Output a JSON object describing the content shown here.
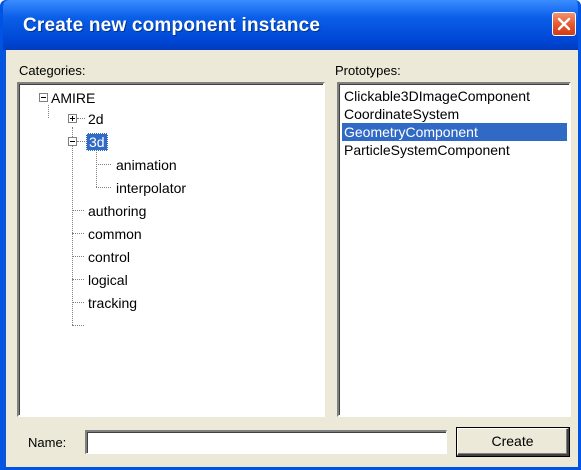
{
  "window": {
    "title": "Create new component instance"
  },
  "categories": {
    "label": "Categories:",
    "tree": {
      "root": "AMIRE",
      "node_2d": "2d",
      "node_3d": "3d",
      "child_animation": "animation",
      "child_interpolator": "interpolator",
      "authoring": "authoring",
      "common": "common",
      "control": "control",
      "logical": "logical",
      "tracking": "tracking"
    }
  },
  "prototypes": {
    "label": "Prototypes:",
    "items": [
      "Clickable3DImageComponent",
      "CoordinateSystem",
      "GeometryComponent",
      "ParticleSystemComponent"
    ],
    "selected_index": 2
  },
  "name_field": {
    "label": "Name:",
    "value": ""
  },
  "create_button": {
    "label": "Create"
  },
  "icons": {
    "close": "close-icon",
    "expand": "plus-icon",
    "collapse": "minus-icon"
  },
  "colors": {
    "titlebar": "#0a5ee8",
    "selection": "#316ac5",
    "dialog_face": "#ece9d8",
    "close_button": "#e4562d"
  }
}
